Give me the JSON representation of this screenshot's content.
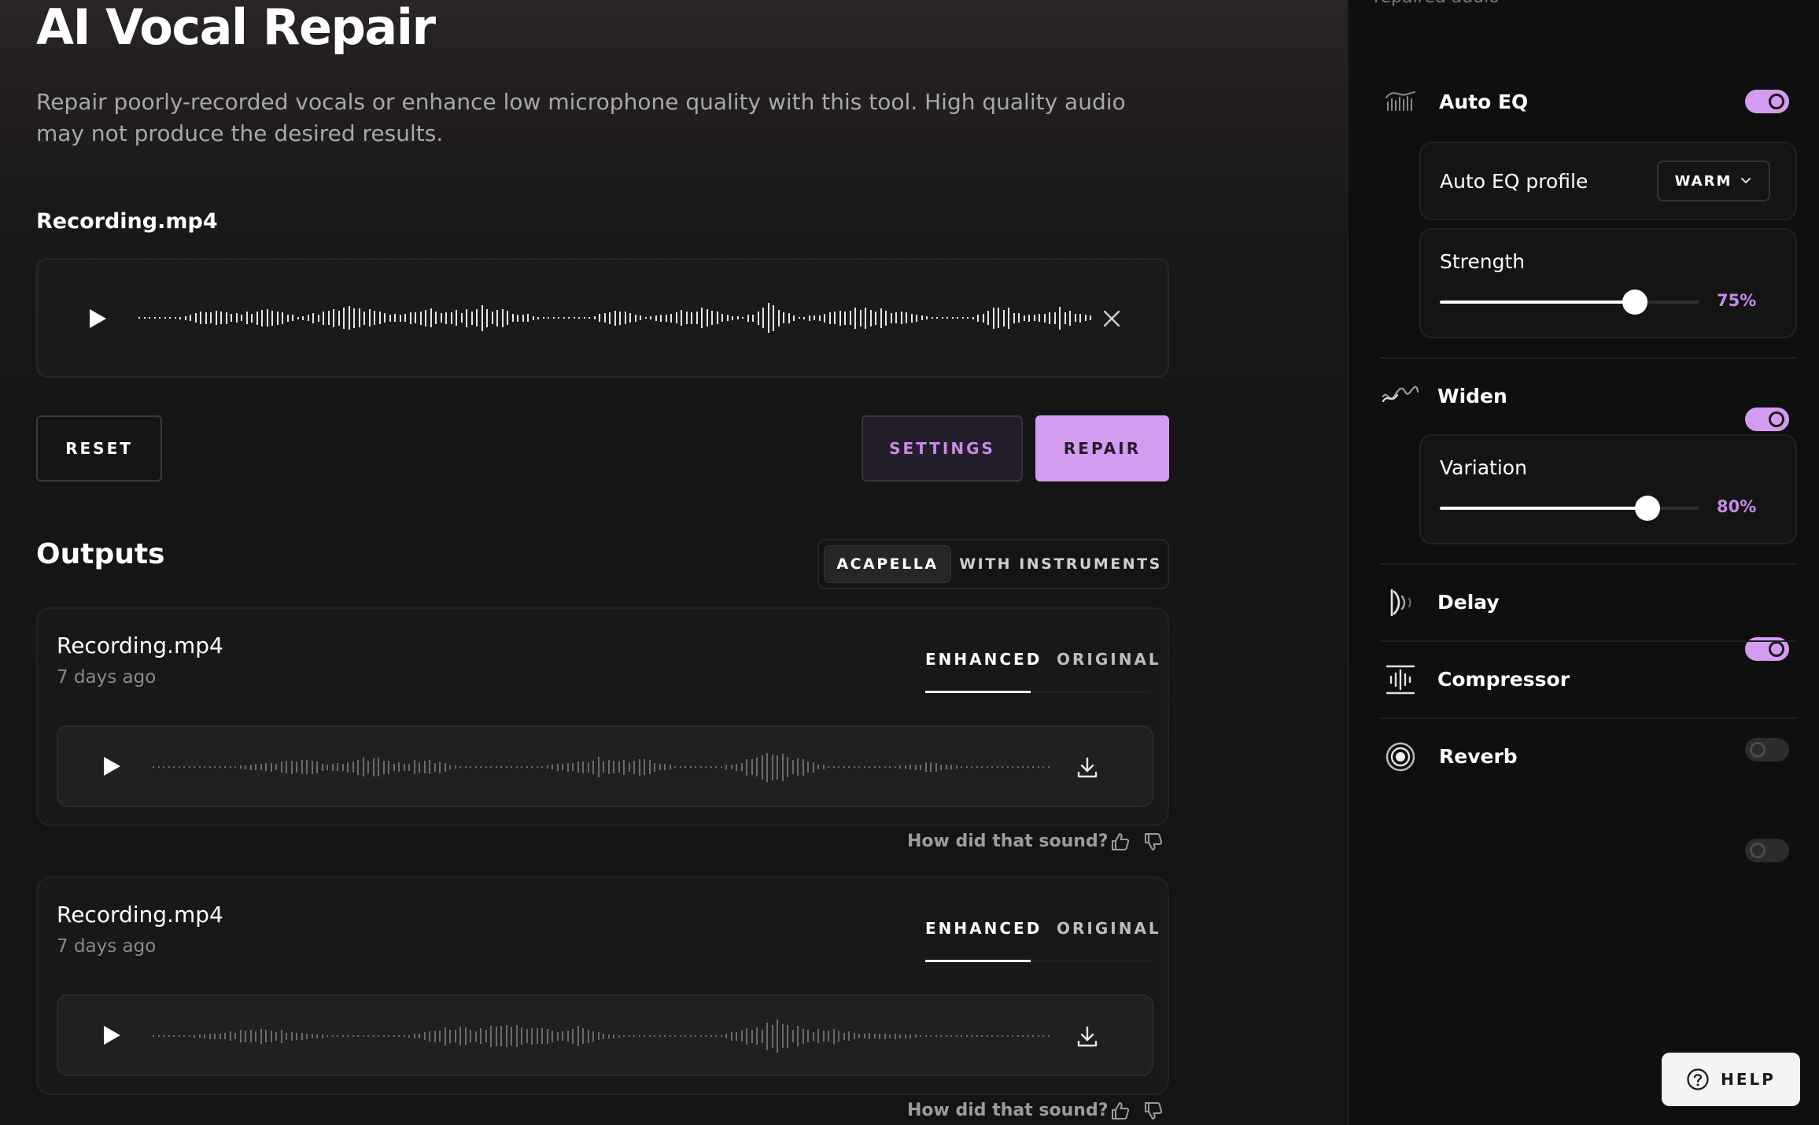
{
  "page": {
    "title": "AI Vocal Repair",
    "description": "Repair poorly-recorded vocals or enhance low microphone quality with this tool. High quality audio may not produce the desired results."
  },
  "input": {
    "file_name": "Recording.mp4"
  },
  "actions": {
    "reset": "RESET",
    "settings": "SETTINGS",
    "repair": "REPAIR"
  },
  "outputs": {
    "heading": "Outputs",
    "modes": [
      "ACAPELLA",
      "WITH INSTRUMENTS"
    ],
    "selected_mode": "ACAPELLA",
    "feedback_prompt": "How did that sound?",
    "items": [
      {
        "title": "Recording.mp4",
        "date": "7 days ago",
        "tabs": [
          "ENHANCED",
          "ORIGINAL"
        ],
        "selected_tab": "ENHANCED"
      },
      {
        "title": "Recording.mp4",
        "date": "7 days ago",
        "tabs": [
          "ENHANCED",
          "ORIGINAL"
        ],
        "selected_tab": "ENHANCED"
      }
    ]
  },
  "settings_panel": {
    "top_cut_text": "repaired audio",
    "auto_eq": {
      "label": "Auto EQ",
      "enabled": true,
      "profile_label": "Auto EQ profile",
      "profile_value": "WARM",
      "strength_label": "Strength",
      "strength_value": "75%",
      "strength": 0.75
    },
    "widen": {
      "label": "Widen",
      "enabled": true,
      "variation_label": "Variation",
      "variation_value": "80%",
      "variation": 0.8
    },
    "delay": {
      "label": "Delay",
      "enabled": true
    },
    "compressor": {
      "label": "Compressor",
      "enabled": false
    },
    "reverb": {
      "label": "Reverb",
      "enabled": false
    }
  },
  "help": {
    "label": "HELP"
  },
  "icons": [
    "play-icon",
    "close-icon",
    "download-icon",
    "thumbs-up-icon",
    "thumbs-down-icon",
    "eq-icon",
    "widen-icon",
    "delay-icon",
    "compressor-icon",
    "reverb-icon",
    "chevron-down-icon",
    "help-icon"
  ],
  "colors": {
    "accent": "#d49cf0",
    "accent_text": "#c88ae8",
    "background": "#141414",
    "panel": "#0f0f0f"
  }
}
